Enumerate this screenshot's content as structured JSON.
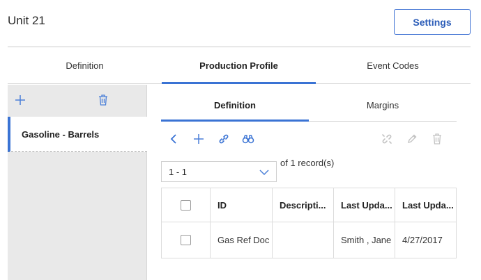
{
  "header": {
    "title": "Unit 21",
    "settings_label": "Settings"
  },
  "main_tabs": [
    {
      "label": "Definition",
      "active": false
    },
    {
      "label": "Production Profile",
      "active": true
    },
    {
      "label": "Event Codes",
      "active": false
    }
  ],
  "left_panel": {
    "toolbar_icons": [
      "plus-icon",
      "trash-icon"
    ],
    "items": [
      {
        "label": "Gasoline - Barrels",
        "selected": true
      }
    ]
  },
  "sub_tabs": [
    {
      "label": "Definition",
      "active": true
    },
    {
      "label": "Margins",
      "active": false
    }
  ],
  "toolbar": {
    "left_icons": [
      "back-chevron-icon",
      "add-icon",
      "link-icon",
      "binoculars-icon"
    ],
    "right_icons": [
      "unlink-icon",
      "edit-pencil-icon",
      "delete-trash-icon"
    ]
  },
  "pager": {
    "range": "1 - 1",
    "records": "of 1 record(s)"
  },
  "grid": {
    "columns": [
      "",
      "ID",
      "Descripti...",
      "Last Upda...",
      "Last Upda..."
    ],
    "rows": [
      [
        "",
        "Gas Ref Doc",
        "",
        "Smith , Jane",
        "4/27/2017"
      ]
    ]
  },
  "colors": {
    "accent": "#3a73d4",
    "panel": "#e9e9e9"
  }
}
